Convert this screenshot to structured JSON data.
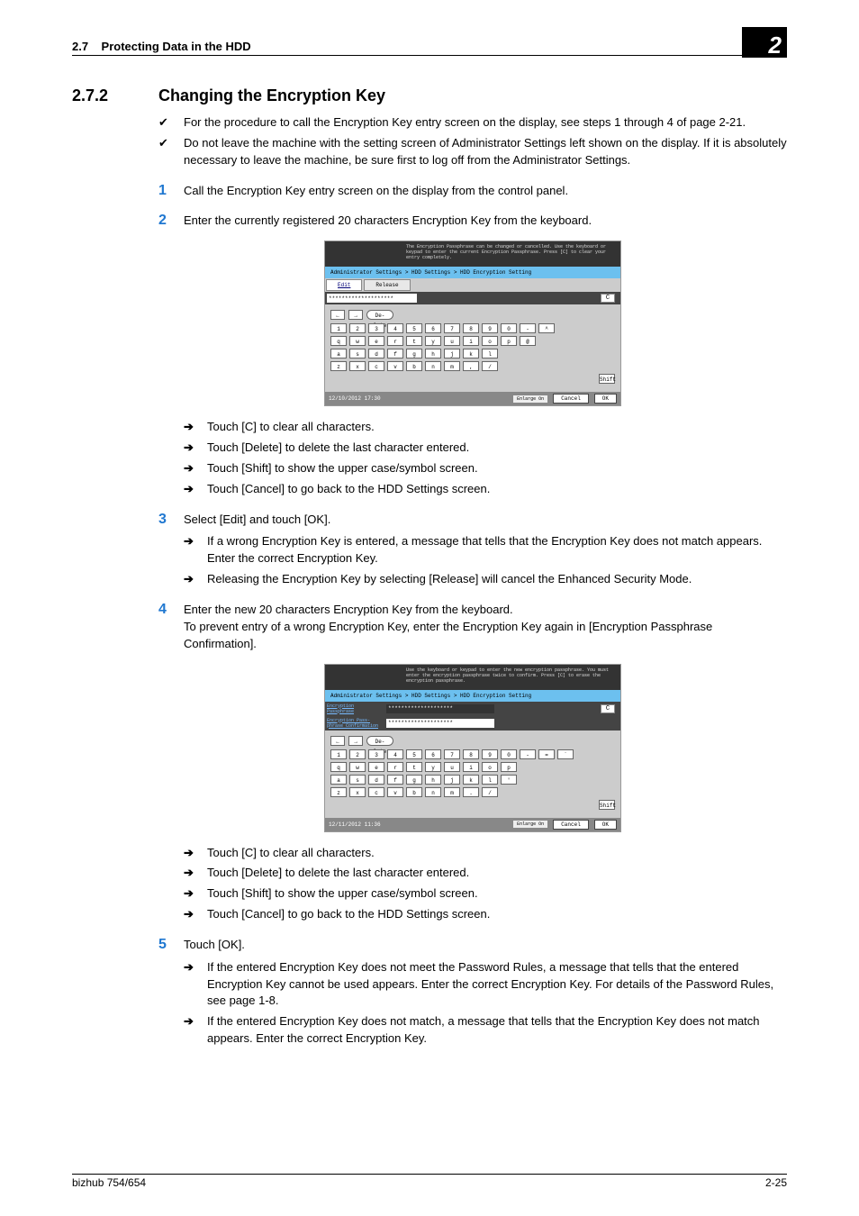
{
  "header": {
    "section_no": "2.7",
    "section_title": "Protecting Data in the HDD",
    "chapter_no": "2"
  },
  "section": {
    "number": "2.7.2",
    "title": "Changing the Encryption Key"
  },
  "prereq": [
    "For the procedure to call the Encryption Key entry screen on the display, see steps 1 through 4 of page 2-21.",
    "Do not leave the machine with the setting screen of Administrator Settings left shown on the display. If it is absolutely necessary to leave the machine, be sure first to log off from the Administrator Settings."
  ],
  "steps": {
    "s1": {
      "n": "1",
      "t": "Call the Encryption Key entry screen on the display from the control panel."
    },
    "s2": {
      "n": "2",
      "t": "Enter the currently registered 20 characters Encryption Key from the keyboard."
    },
    "s2_arrows": [
      "Touch [C] to clear all characters.",
      "Touch [Delete] to delete the last character entered.",
      "Touch [Shift] to show the upper case/symbol screen.",
      "Touch [Cancel] to go back to the HDD Settings screen."
    ],
    "s3": {
      "n": "3",
      "t": "Select [Edit] and touch [OK]."
    },
    "s3_arrows": [
      "If a wrong Encryption Key is entered, a message that tells that the Encryption Key does not match appears. Enter the correct Encryption Key.",
      "Releasing the Encryption Key by selecting [Release] will cancel the Enhanced Security Mode."
    ],
    "s4": {
      "n": "4",
      "t1": "Enter the new 20 characters Encryption Key from the keyboard.",
      "t2": "To prevent entry of a wrong Encryption Key, enter the Encryption Key again in [Encryption Passphrase Confirmation]."
    },
    "s4_arrows": [
      "Touch [C] to clear all characters.",
      "Touch [Delete] to delete the last character entered.",
      "Touch [Shift] to show the upper case/symbol screen.",
      "Touch [Cancel] to go back to the HDD Settings screen."
    ],
    "s5": {
      "n": "5",
      "t": "Touch [OK]."
    },
    "s5_arrows": [
      "If the entered Encryption Key does not meet the Password Rules, a message that tells that the entered Encryption Key cannot be used appears. Enter the correct Encryption Key. For details of the Password Rules, see page 1-8.",
      "If the entered Encryption Key does not match, a message that tells that the Encryption Key does not match appears. Enter the correct Encryption Key."
    ]
  },
  "arrow_glyph": "➔",
  "check_glyph": "✔",
  "screenshot1": {
    "top_msg": "The Encryption Passphrase can be changed or cancelled. Use the keyboard or keypad to enter the current Encryption Passphrase. Press [C] to clear your entry completely.",
    "breadcrumb": "Administrator Settings > HDD Settings > HDD Encryption Setting",
    "tabs": {
      "edit": "Edit",
      "release": "Release"
    },
    "value": "********************",
    "c": "C",
    "delete": "De-\nlete",
    "row1": [
      "1",
      "2",
      "3",
      "4",
      "5",
      "6",
      "7",
      "8",
      "9",
      "0",
      "-",
      "^"
    ],
    "row2": [
      "q",
      "w",
      "e",
      "r",
      "t",
      "y",
      "u",
      "i",
      "o",
      "p",
      "@"
    ],
    "row3": [
      "a",
      "s",
      "d",
      "f",
      "g",
      "h",
      "j",
      "k",
      "l"
    ],
    "row4": [
      "z",
      "x",
      "c",
      "v",
      "b",
      "n",
      "m",
      ",",
      "/"
    ],
    "shift": "Shift",
    "datetime": "12/10/2012   17:30",
    "enlarge": "Enlarge On",
    "cancel": "Cancel",
    "ok": "OK"
  },
  "screenshot2": {
    "top_msg": "Use the keyboard or keypad to enter the new encryption passphrase. You must enter the encryption passphrase twice to confirm. Press [C] to erase the encryption passphrase.",
    "breadcrumb": "Administrator Settings > HDD Settings > HDD Encryption Setting",
    "label1": "Encryption Passphrase",
    "label2": "Encryption Pass- phrase Confirmation",
    "value": "********************",
    "c": "C",
    "delete": "De-\nlete",
    "row1": [
      "1",
      "2",
      "3",
      "4",
      "5",
      "6",
      "7",
      "8",
      "9",
      "0",
      "-",
      "=",
      "`"
    ],
    "row2": [
      "q",
      "w",
      "e",
      "r",
      "t",
      "y",
      "u",
      "i",
      "o",
      "p"
    ],
    "row3": [
      "a",
      "s",
      "d",
      "f",
      "g",
      "h",
      "j",
      "k",
      "l",
      "'"
    ],
    "row4": [
      "z",
      "x",
      "c",
      "v",
      "b",
      "n",
      "m",
      ".",
      "/"
    ],
    "shift": "Shift",
    "datetime": "12/11/2012   11:36",
    "enlarge": "Enlarge On",
    "cancel": "Cancel",
    "ok": "OK"
  },
  "footer": {
    "model": "bizhub 754/654",
    "pageno": "2-25"
  }
}
